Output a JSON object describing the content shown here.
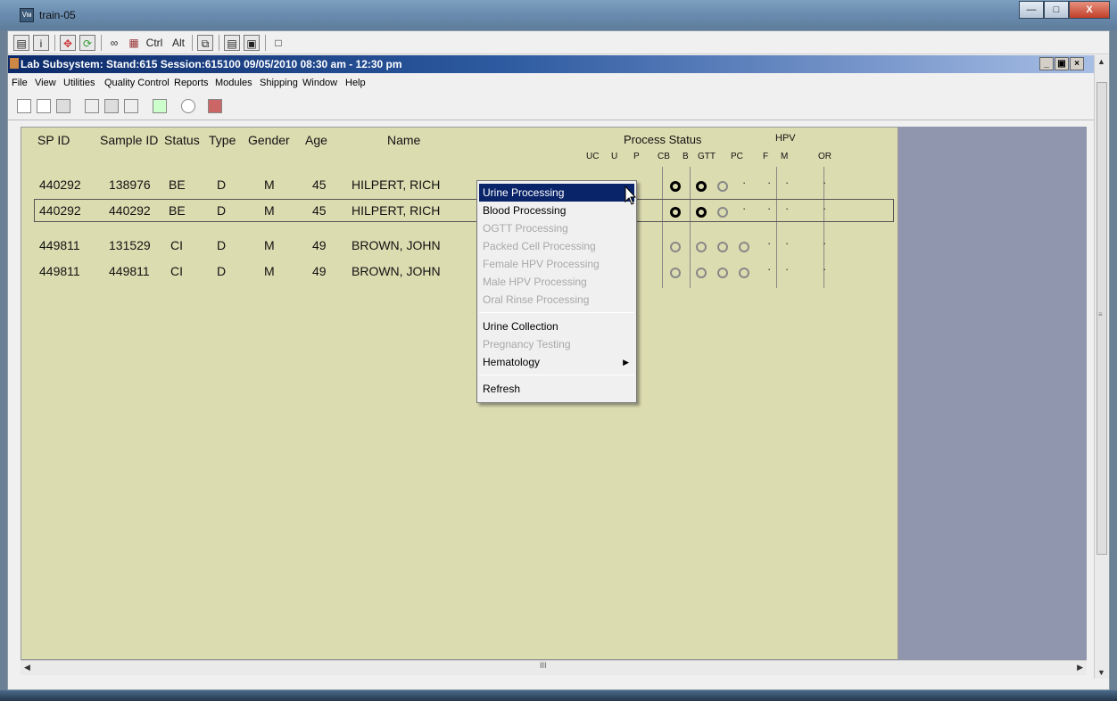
{
  "window": {
    "title": "train-05",
    "app_icon": "app-icon"
  },
  "toolbar1": {
    "ctrl": "Ctrl",
    "alt": "Alt"
  },
  "mdi": {
    "title": "Lab Subsystem: Stand:615 Session:615100 09/05/2010 08:30 am - 12:30 pm"
  },
  "menu": [
    "File",
    "View",
    "Utilities",
    "Quality Control",
    "Reports",
    "Modules",
    "Shipping",
    "Window",
    "Help"
  ],
  "columns": {
    "sp_id": "SP ID",
    "sample_id": "Sample ID",
    "status": "Status",
    "type": "Type",
    "gender": "Gender",
    "age": "Age",
    "name": "Name",
    "process_status": "Process Status",
    "hpv": "HPV",
    "sub": [
      "UC",
      "U",
      "P",
      "CB",
      "B",
      "GTT",
      "PC",
      "F",
      "M",
      "OR"
    ]
  },
  "rows": [
    {
      "sp_id": "440292",
      "sample_id": "138976",
      "status": "BE",
      "type": "D",
      "gender": "M",
      "age": "45",
      "name": "HILPERT, RICH"
    },
    {
      "sp_id": "440292",
      "sample_id": "440292",
      "status": "BE",
      "type": "D",
      "gender": "M",
      "age": "45",
      "name": "HILPERT, RICH"
    },
    {
      "sp_id": "449811",
      "sample_id": "131529",
      "status": "CI",
      "type": "D",
      "gender": "M",
      "age": "49",
      "name": "BROWN, JOHN"
    },
    {
      "sp_id": "449811",
      "sample_id": "449811",
      "status": "CI",
      "type": "D",
      "gender": "M",
      "age": "49",
      "name": "BROWN, JOHN"
    }
  ],
  "context_menu": {
    "items": [
      {
        "label": "Urine Processing",
        "enabled": true,
        "highlighted": true
      },
      {
        "label": "Blood Processing",
        "enabled": true
      },
      {
        "label": "OGTT Processing",
        "enabled": false
      },
      {
        "label": "Packed Cell Processing",
        "enabled": false
      },
      {
        "label": "Female HPV Processing",
        "enabled": false
      },
      {
        "label": "Male HPV Processing",
        "enabled": false
      },
      {
        "label": "Oral Rinse Processing",
        "enabled": false
      },
      {
        "label": "Urine Collection",
        "enabled": true
      },
      {
        "label": "Pregnancy Testing",
        "enabled": false
      },
      {
        "label": "Hematology",
        "enabled": true,
        "submenu": true
      },
      {
        "label": "Refresh",
        "enabled": true
      }
    ]
  },
  "colors": {
    "grid_bg": "#dcdcb1",
    "right_panel": "#9096ae",
    "highlight": "#0a246a",
    "mdi_title": "#0c2a6a"
  }
}
